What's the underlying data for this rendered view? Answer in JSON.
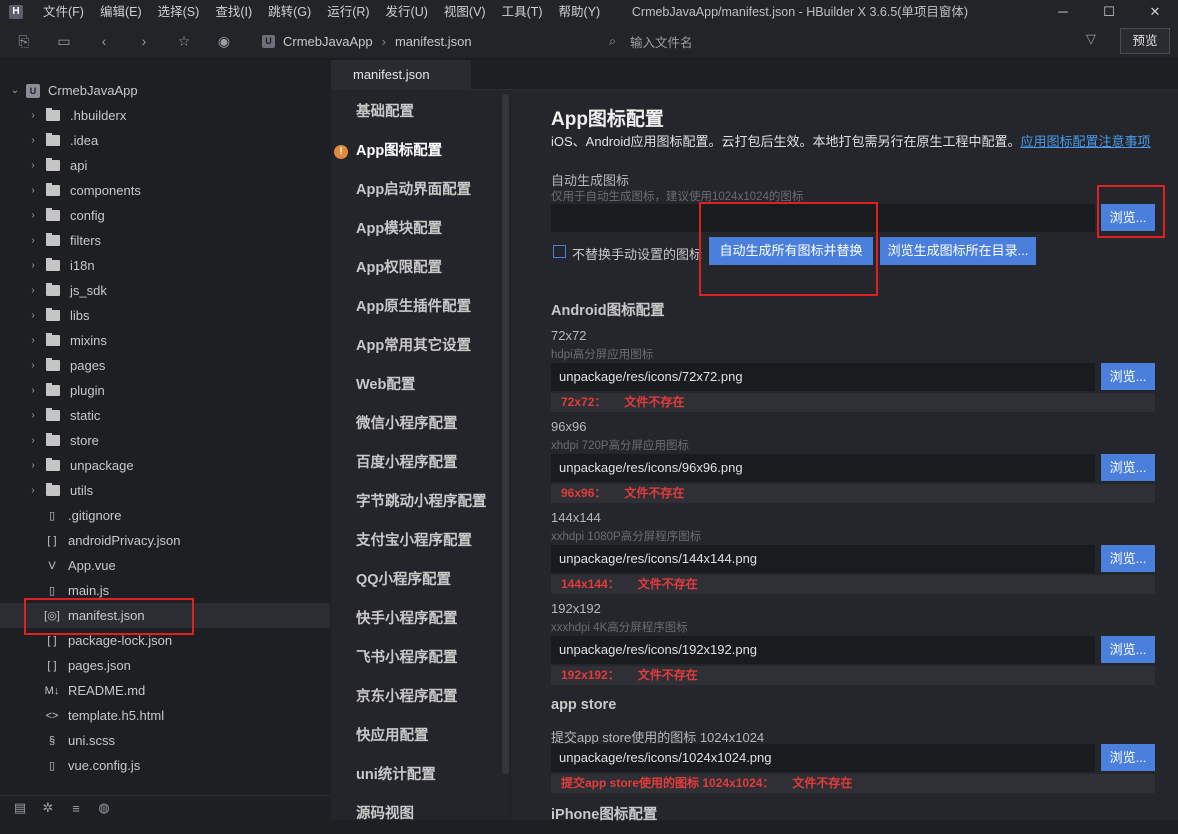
{
  "titlebar": {
    "logo": "H",
    "menus": [
      "文件(F)",
      "编辑(E)",
      "选择(S)",
      "查找(I)",
      "跳转(G)",
      "运行(R)",
      "发行(U)",
      "视图(V)",
      "工具(T)",
      "帮助(Y)"
    ],
    "title": "CrmebJavaApp/manifest.json - HBuilder X 3.6.5(单项目窗体)"
  },
  "toolbar": {
    "project": "CrmebJavaApp",
    "file": "manifest.json",
    "file_search_placeholder": "输入文件名",
    "preview": "预览"
  },
  "tree": {
    "root": "CrmebJavaApp",
    "folders": [
      ".hbuilderx",
      ".idea",
      "api",
      "components",
      "config",
      "filters",
      "i18n",
      "js_sdk",
      "libs",
      "mixins",
      "pages",
      "plugin",
      "static",
      "store",
      "unpackage",
      "utils"
    ],
    "files": [
      {
        "name": ".gitignore",
        "icon": "doc"
      },
      {
        "name": "androidPrivacy.json",
        "icon": "json"
      },
      {
        "name": "App.vue",
        "icon": "vue"
      },
      {
        "name": "main.js",
        "icon": "doc"
      },
      {
        "name": "manifest.json",
        "icon": "manifest"
      },
      {
        "name": "package-lock.json",
        "icon": "json"
      },
      {
        "name": "pages.json",
        "icon": "json"
      },
      {
        "name": "README.md",
        "icon": "md"
      },
      {
        "name": "template.h5.html",
        "icon": "html"
      },
      {
        "name": "uni.scss",
        "icon": "scss"
      },
      {
        "name": "vue.config.js",
        "icon": "doc"
      }
    ],
    "selected": "manifest.json"
  },
  "editor": {
    "tab": "manifest.json",
    "nav": [
      "基础配置",
      "App图标配置",
      "App启动界面配置",
      "App模块配置",
      "App权限配置",
      "App原生插件配置",
      "App常用其它设置",
      "Web配置",
      "微信小程序配置",
      "百度小程序配置",
      "字节跳动小程序配置",
      "支付宝小程序配置",
      "QQ小程序配置",
      "快手小程序配置",
      "飞书小程序配置",
      "京东小程序配置",
      "快应用配置",
      "uni统计配置",
      "源码视图"
    ],
    "active_nav": "App图标配置"
  },
  "main": {
    "title": "App图标配置",
    "desc": "iOS、Android应用图标配置。云打包后生效。本地打包需另行在原生工程中配置。",
    "desc_link": "应用图标配置注意事项",
    "auto": {
      "label": "自动生成图标",
      "hint": "仅用于自动生成图标，建议使用1024x1024的图标",
      "value": "",
      "browse": "浏览...",
      "checkbox_label": "不替换手动设置的图标",
      "btn_generate": "自动生成所有图标并替换",
      "btn_open_dir": "浏览生成图标所在目录..."
    },
    "android_title": "Android图标配置",
    "icons": [
      {
        "size": "72x72",
        "hint": "hdpi高分屏应用图标",
        "value": "unpackage/res/icons/72x72.png",
        "err_key": "72x72：",
        "err": "文件不存在"
      },
      {
        "size": "96x96",
        "hint": "xhdpi 720P高分屏应用图标",
        "value": "unpackage/res/icons/96x96.png",
        "err_key": "96x96：",
        "err": "文件不存在"
      },
      {
        "size": "144x144",
        "hint": "xxhdpi 1080P高分屏程序图标",
        "value": "unpackage/res/icons/144x144.png",
        "err_key": "144x144：",
        "err": "文件不存在"
      },
      {
        "size": "192x192",
        "hint": "xxxhdpi 4K高分屏程序图标",
        "value": "unpackage/res/icons/192x192.png",
        "err_key": "192x192：",
        "err": "文件不存在"
      }
    ],
    "appstore": {
      "title": "app store",
      "label": "提交app store使用的图标 1024x1024",
      "value": "unpackage/res/icons/1024x1024.png",
      "err_key": "提交app store使用的图标 1024x1024：",
      "err": "文件不存在"
    },
    "iphone_title": "iPhone图标配置",
    "browse_label": "浏览..."
  }
}
